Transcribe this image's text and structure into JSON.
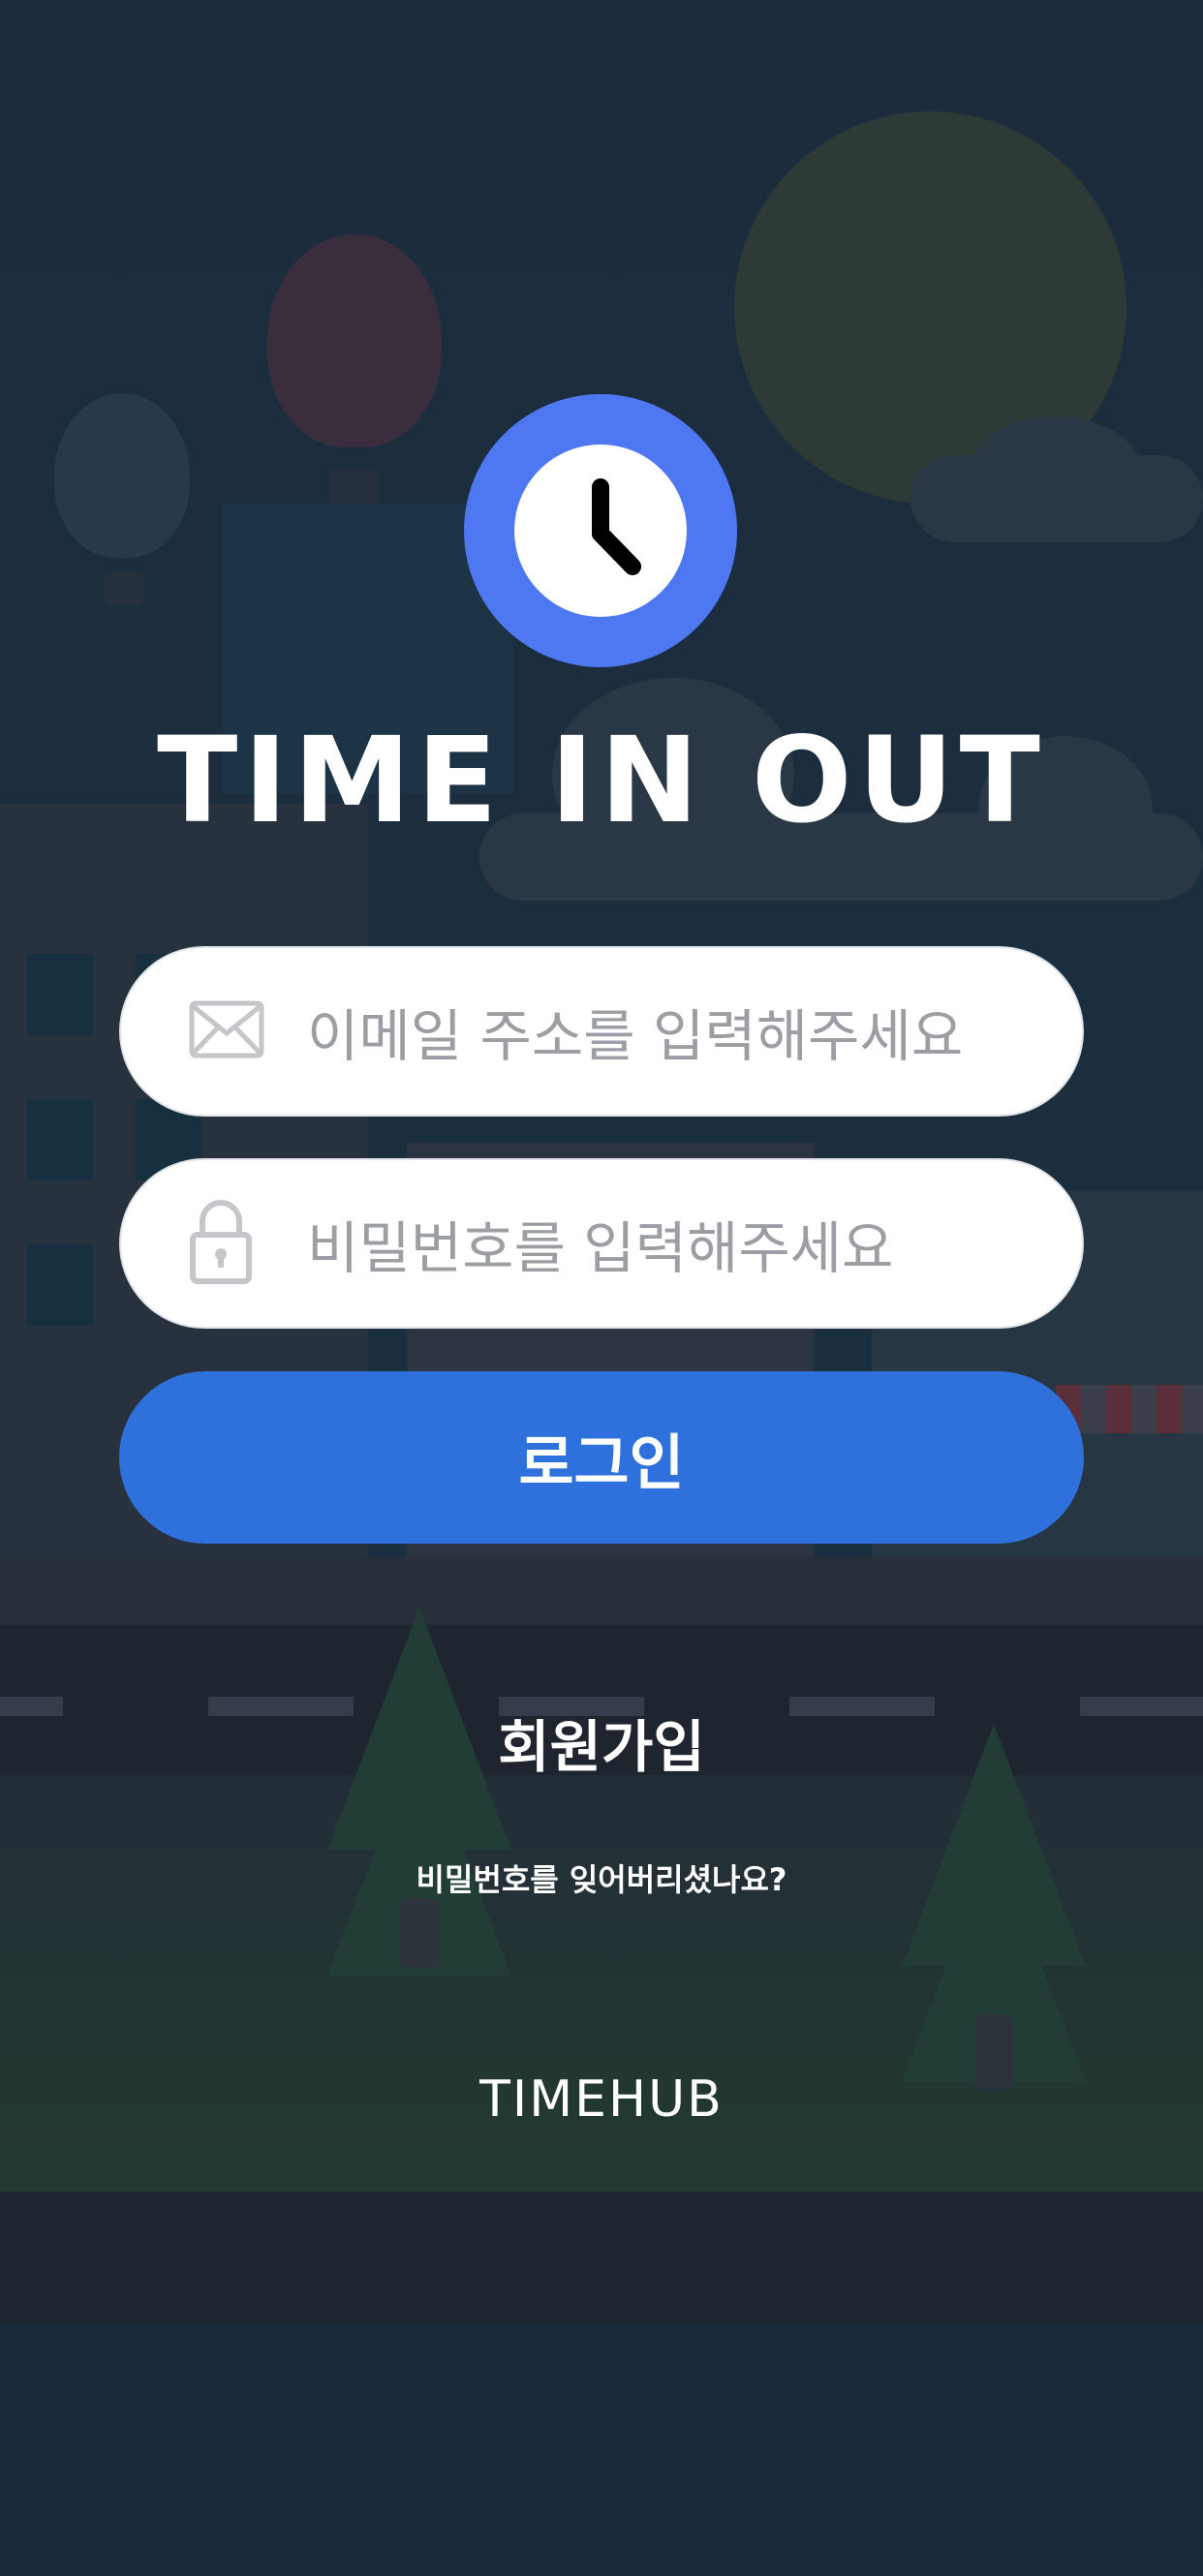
{
  "app": {
    "title": "TIME IN OUT",
    "brand": "TIMEHUB"
  },
  "login": {
    "email_placeholder": "이메일 주소를 입력해주세요",
    "password_placeholder": "비밀번호를 입력해주세요",
    "login_label": "로그인",
    "signup_label": "회원가입",
    "forgot_label": "비밀번호를 잊어버리셨나요?"
  },
  "icons": {
    "logo": "clock-icon",
    "email": "envelope-icon",
    "password": "lock-icon"
  },
  "colors": {
    "accent": "#4d78f2",
    "button": "#2e71dc",
    "background": "#1b2a3a",
    "placeholder": "#9b9ea3"
  }
}
